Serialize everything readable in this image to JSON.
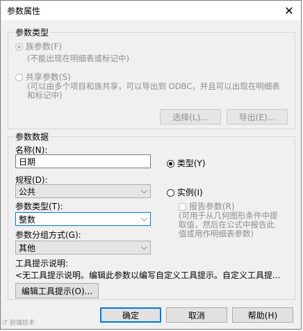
{
  "window": {
    "title": "参数属性",
    "close_glyph": "✕"
  },
  "param_type_group": {
    "legend": "参数类型",
    "family_radio": "族参数(F)",
    "family_desc": "(不能出现在明细表或标记中)",
    "shared_radio": "共享参数(S)",
    "shared_desc_line1": "(可以由多个项目和族共享，可以导出到 ODBC，并且可以出现在明细表",
    "shared_desc_line2": "和标记中)",
    "select_button": "选择(L)...",
    "export_button": "导出(E)..."
  },
  "param_data_group": {
    "legend": "参数数据",
    "name_label": "名称(N):",
    "name_value": "日期",
    "type_radio": "类型(Y)",
    "discipline_label": "规程(D):",
    "discipline_value": "公共",
    "instance_radio": "实例(I)",
    "param_type_label": "参数类型(T):",
    "param_type_value": "整数",
    "report_checkbox": "报告参数(R)",
    "report_desc_line1": "(可用于从几何图形条件中提",
    "report_desc_line2": "取值，然后在公式中报告此",
    "report_desc_line3": "值或用作明细表参数)",
    "group_label": "参数分组方式(G):",
    "group_value": "其他"
  },
  "tooltip": {
    "label": "工具提示说明:",
    "text": "<无工具提示说明。编辑此参数以编写自定义工具提示。自定义工具提...",
    "edit_button": "编辑工具提示(O)..."
  },
  "footer": {
    "ok_button": "确定",
    "cancel_button": "取消",
    "help_button": "帮助(H)"
  },
  "watermark": "iT 前端技术"
}
